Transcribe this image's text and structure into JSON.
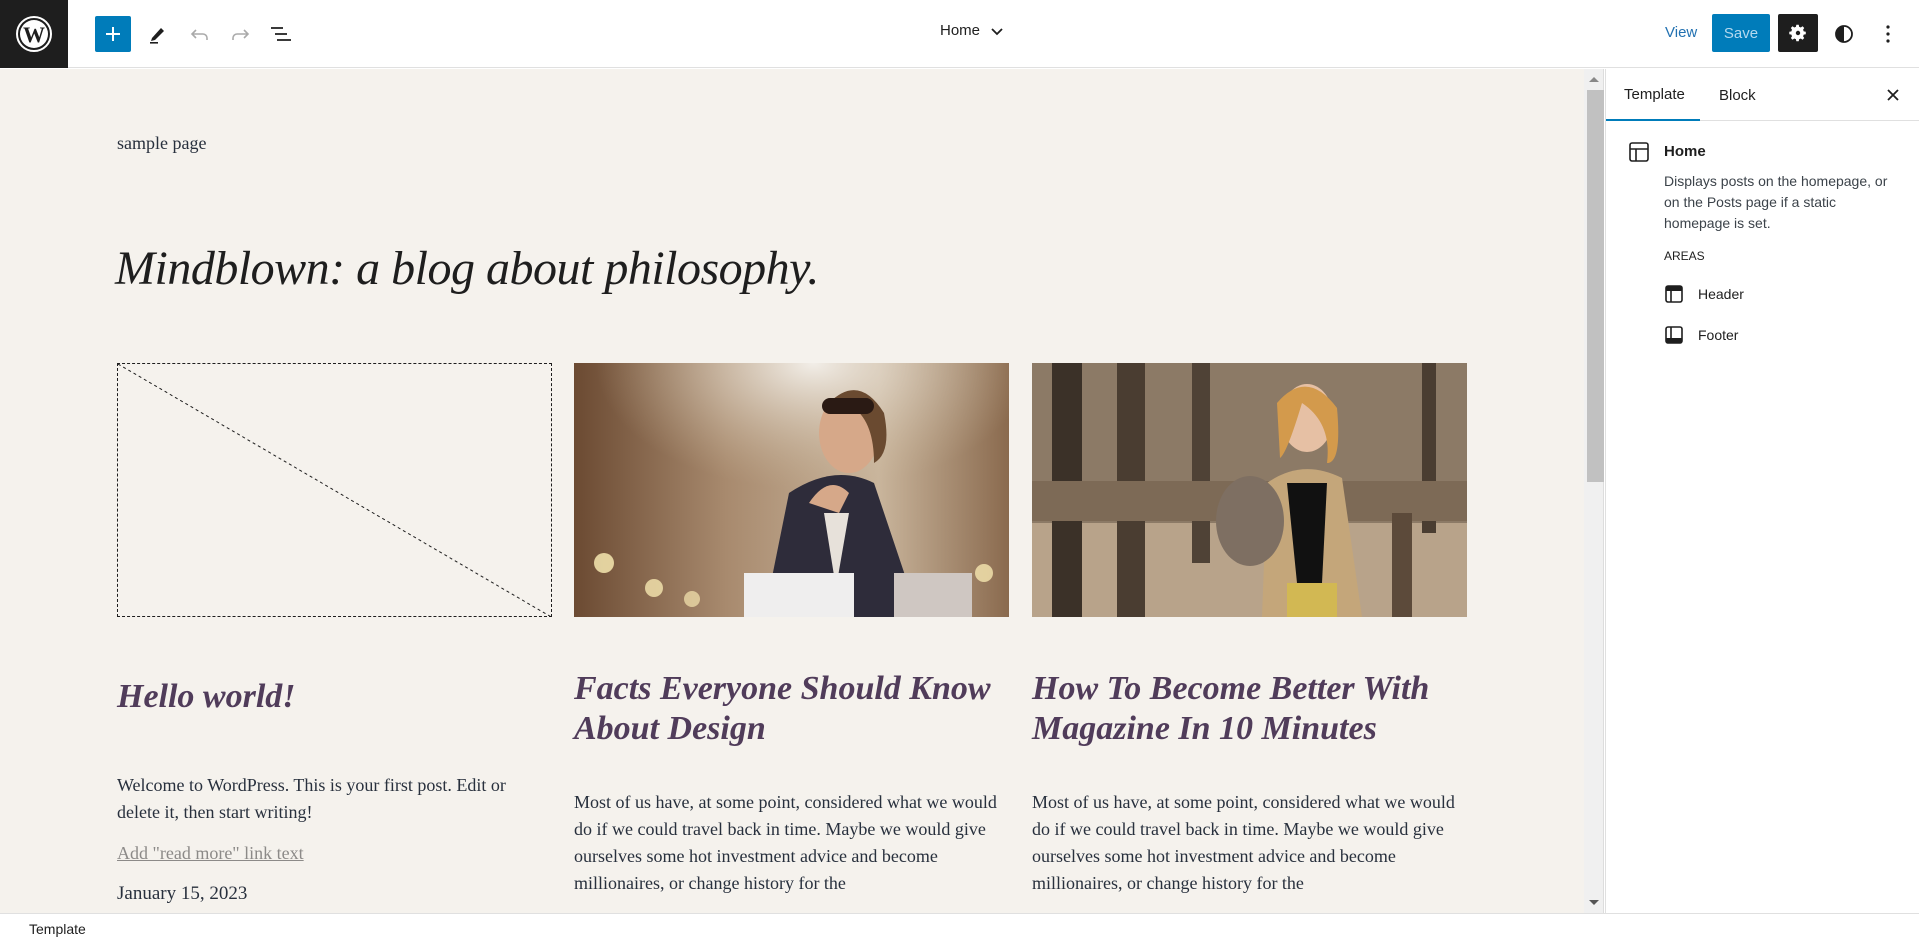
{
  "topbar": {
    "logo": "wordpress-logo",
    "add_block_label": "+",
    "doc_title": "Home",
    "view_label": "View",
    "save_label": "Save",
    "colors": {
      "accent": "#007cba",
      "dark": "#1e1e1e"
    }
  },
  "canvas": {
    "nav_link": "sample page",
    "site_title": "Mindblown: a blog about philosophy.",
    "background": "#f5f2ed",
    "posts": [
      {
        "title": "Hello world!",
        "image": "placeholder",
        "excerpt": "Welcome to WordPress. This is your first post. Edit or delete it, then start writing!",
        "read_more": "Add \"read more\" link text",
        "date": "January 15, 2023"
      },
      {
        "title": "Facts Everyone Should Know About Design",
        "image": "woman-with-shopping-bags-photo",
        "excerpt": "Most of us have, at some point, considered what we would do if we could travel back in time. Maybe we would give ourselves some hot investment advice and become millionaires, or change history for the"
      },
      {
        "title": "How To Become Better With Magazine In 10 Minutes",
        "image": "woman-at-fence-photo",
        "excerpt": "Most of us have, at some point, considered what we would do if we could travel back in time. Maybe we would give ourselves some hot investment advice and become millionaires, or change history for the"
      }
    ]
  },
  "sidebar": {
    "tabs": [
      {
        "label": "Template",
        "active": true
      },
      {
        "label": "Block",
        "active": false
      }
    ],
    "template": {
      "name": "Home",
      "description": "Displays posts on the homepage, or on the Posts page if a static homepage is set.",
      "areas_label": "AREAS",
      "areas": [
        {
          "label": "Header",
          "icon": "header-icon"
        },
        {
          "label": "Footer",
          "icon": "footer-icon"
        }
      ]
    }
  },
  "footer": {
    "breadcrumb": "Template"
  }
}
